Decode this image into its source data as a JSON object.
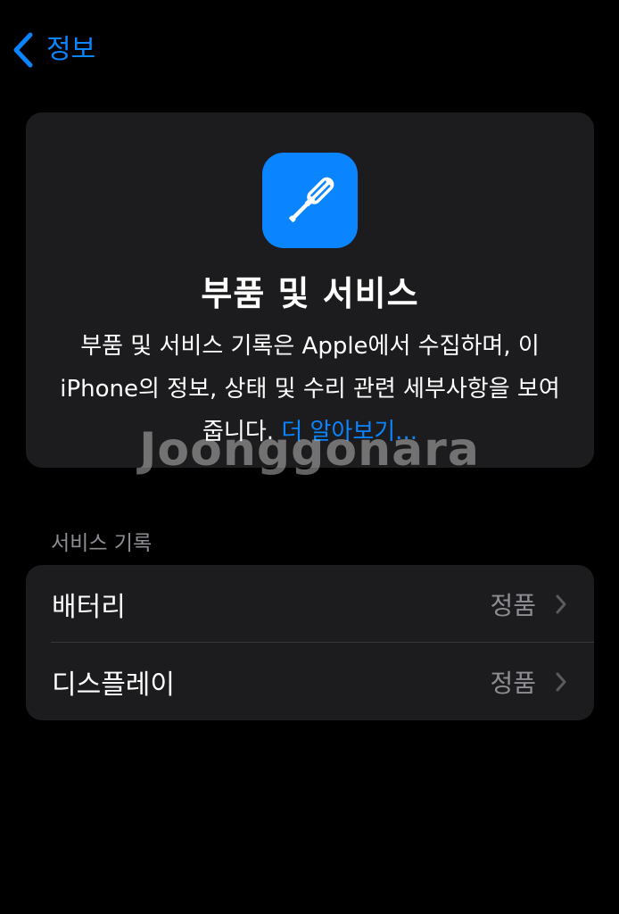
{
  "nav": {
    "back_label": "정보",
    "accent_color": "#0a84ff"
  },
  "hero": {
    "icon": "screwdriver-icon",
    "title": "부품 및 서비스",
    "description": "부품 및 서비스 기록은 Apple에서 수집하며, 이 iPhone의 정보, 상태 및 수리 관련 세부사항을 보여줍니다.",
    "learn_more": "더 알아보기..."
  },
  "watermark": "Joonggonara",
  "service_history": {
    "header": "서비스 기록",
    "rows": [
      {
        "label": "배터리",
        "value": "정품"
      },
      {
        "label": "디스플레이",
        "value": "정품"
      }
    ]
  }
}
